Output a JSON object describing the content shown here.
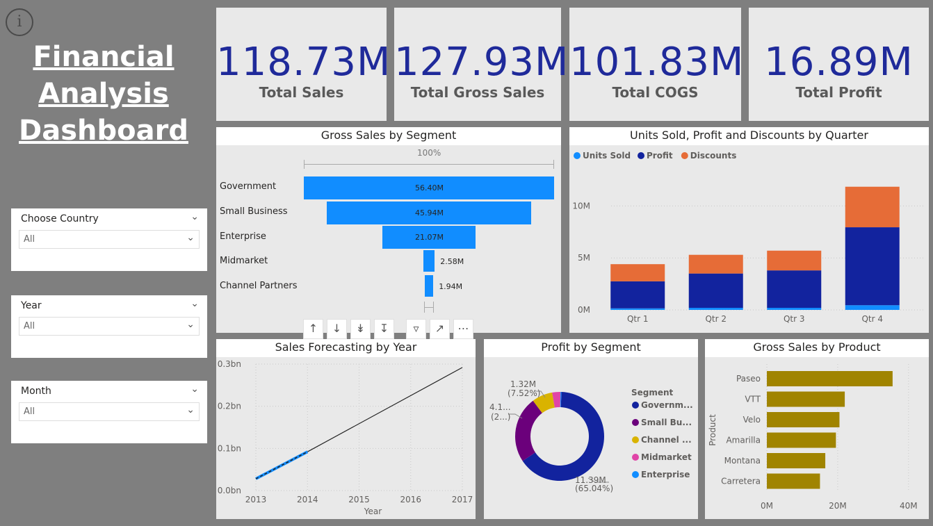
{
  "dashboard": {
    "title_line1": "Financial",
    "title_line2": "Analysis",
    "title_line3": "Dashboard",
    "info_glyph": "i"
  },
  "kpis": [
    {
      "value": "118.73M",
      "label": "Total Sales"
    },
    {
      "value": "127.93M",
      "label": "Total Gross Sales"
    },
    {
      "value": "101.83M",
      "label": "Total COGS"
    },
    {
      "value": "16.89M",
      "label": "Total Profit"
    }
  ],
  "slicers": [
    {
      "title": "Choose Country",
      "value": "All"
    },
    {
      "title": "Year",
      "value": "All"
    },
    {
      "title": "Month",
      "value": "All"
    }
  ],
  "funnel": {
    "title": "Gross Sales by Segment",
    "top_label": "100%",
    "segments": [
      {
        "name": "Government",
        "value": 56.4,
        "label": "56.40M"
      },
      {
        "name": "Small Business",
        "value": 45.94,
        "label": "45.94M"
      },
      {
        "name": "Enterprise",
        "value": 21.07,
        "label": "21.07M"
      },
      {
        "name": "Midmarket",
        "value": 2.58,
        "label": "2.58M"
      },
      {
        "name": "Channel Partners",
        "value": 1.94,
        "label": "1.94M"
      }
    ]
  },
  "visual_toolbar": {
    "icons": [
      "arrow-up-icon",
      "arrow-down-icon",
      "double-arrow-down-icon",
      "expand-hierarchy-icon",
      "filter-icon",
      "focus-mode-icon",
      "more-options-icon"
    ]
  },
  "colors": {
    "units_sold": "#118dff",
    "profit": "#12239e",
    "discounts": "#e66c37",
    "kpi_value": "#1f2a9a",
    "product_bar": "#a08400",
    "forecast_actual": "#118dff"
  },
  "chart_data": [
    {
      "type": "bar",
      "stacked": true,
      "title": "Units Sold, Profit and Discounts by Quarter",
      "categories": [
        "Qtr 1",
        "Qtr 2",
        "Qtr 3",
        "Qtr 4"
      ],
      "series": [
        {
          "name": "Units Sold",
          "values": [
            0.15,
            0.2,
            0.2,
            0.45
          ]
        },
        {
          "name": "Profit",
          "values": [
            2.6,
            3.3,
            3.6,
            7.5
          ]
        },
        {
          "name": "Discounts",
          "values": [
            1.65,
            1.8,
            1.9,
            3.9
          ]
        }
      ],
      "y_ticks": [
        "0M",
        "5M",
        "10M"
      ],
      "ylim": [
        0,
        12.5
      ],
      "legend": "top-left"
    },
    {
      "type": "line",
      "title": "Sales Forecasting by Year",
      "xlabel": "Year",
      "x_ticks": [
        "2013",
        "2014",
        "2015",
        "2016",
        "2017"
      ],
      "y_ticks": [
        "0.0bn",
        "0.1bn",
        "0.2bn",
        "0.3bn"
      ],
      "ylim": [
        0,
        0.3
      ],
      "series": [
        {
          "values_x": [
            2013,
            2014
          ],
          "values_y": [
            0.028,
            0.092
          ]
        },
        {
          "values_x": [
            2014,
            2017
          ],
          "values_y": [
            0.092,
            0.292
          ]
        }
      ]
    },
    {
      "type": "pie",
      "donut": true,
      "title": "Profit by Segment",
      "legend_title": "Segment",
      "legend_items": [
        "Governm...",
        "Small Bu...",
        "Channel ...",
        "Midmarket",
        "Enterprise"
      ],
      "slices": [
        {
          "name": "Government",
          "value": 65.04,
          "color": "#12239e"
        },
        {
          "name": "Small Business",
          "value": 24.1,
          "color": "#6b007b"
        },
        {
          "name": "Channel Partners",
          "value": 7.52,
          "color": "#d9b300"
        },
        {
          "name": "Midmarket",
          "value": 3.0,
          "color": "#e044a7"
        },
        {
          "name": "Enterprise",
          "value": 0.34,
          "color": "#118dff"
        }
      ],
      "labels": [
        {
          "line1": "11.39M",
          "line2": "(65.04%)"
        },
        {
          "line1": "4.1...",
          "line2": "(2...)"
        },
        {
          "line1": "1.32M",
          "line2": "(7.52%)"
        }
      ]
    },
    {
      "type": "bar",
      "orientation": "horizontal",
      "title": "Gross Sales by Product",
      "ylabel": "Product",
      "categories": [
        "Paseo",
        "VTT",
        "Velo",
        "Amarilla",
        "Montana",
        "Carretera"
      ],
      "values": [
        35.5,
        22,
        20.5,
        19.5,
        16.5,
        15
      ],
      "x_ticks": [
        "0M",
        "20M",
        "40M"
      ],
      "xlim": [
        0,
        42
      ]
    }
  ]
}
